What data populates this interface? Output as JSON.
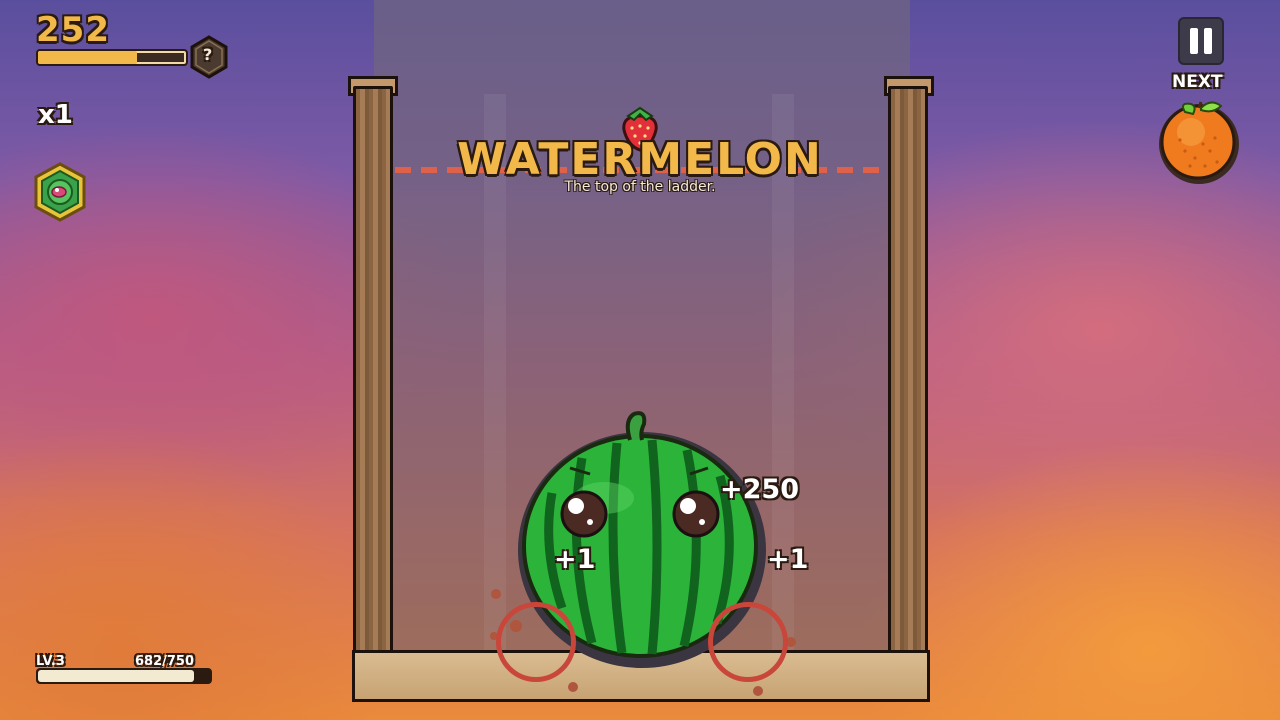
{
  "hud": {
    "score": "252",
    "score_progress": 0.67,
    "hint_symbol": "?",
    "multiplier": "x1",
    "next_label": "NEXT",
    "next_fruit": "orange-icon",
    "level_label": "LV.3",
    "xp_label": "682/750",
    "xp_progress": 0.909
  },
  "banner": {
    "title": "WATERMELON",
    "subtitle": "The top of the ladder."
  },
  "popups": {
    "main": "+250",
    "left": "+1",
    "right": "+1"
  },
  "colors": {
    "gold": "#f2b94a",
    "outline": "#2a1a10",
    "watermelon_green": "#2bb33a",
    "danger_line": "#e0614a"
  }
}
